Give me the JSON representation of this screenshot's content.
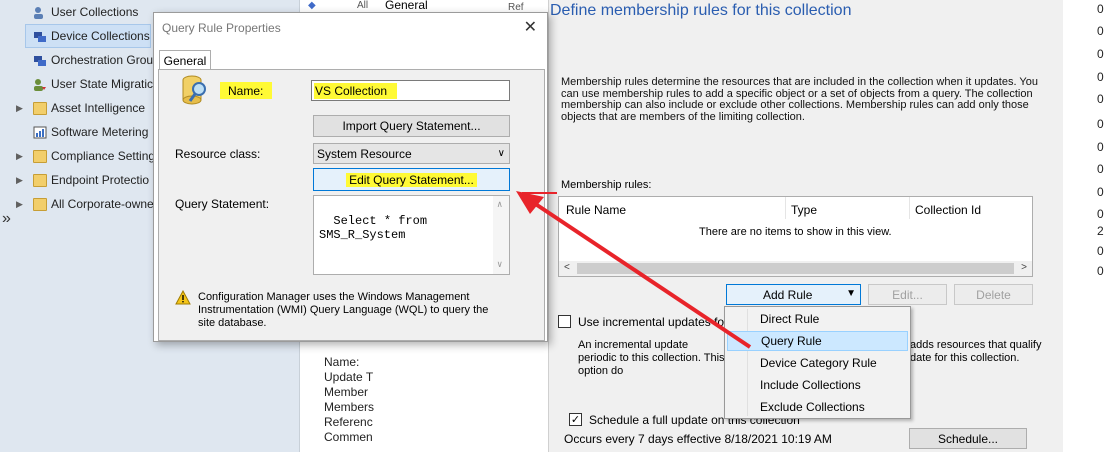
{
  "nav": {
    "items": [
      {
        "label": "User Collections",
        "icon": "user-collections-icon"
      },
      {
        "label": "Device Collections",
        "icon": "device-collections-icon",
        "selected": true
      },
      {
        "label": "Orchestration Grou",
        "icon": "orchestration-groups-icon"
      },
      {
        "label": "User State Migratic",
        "icon": "user-state-migration-icon"
      },
      {
        "label": "Asset Intelligence",
        "icon": "folder-icon",
        "expandable": true
      },
      {
        "label": "Software Metering",
        "icon": "software-metering-icon"
      },
      {
        "label": "Compliance Setting",
        "icon": "folder-icon",
        "expandable": true
      },
      {
        "label": "Endpoint Protectio",
        "icon": "folder-icon",
        "expandable": true
      },
      {
        "label": "All Corporate-owne",
        "icon": "folder-icon",
        "expandable": true
      }
    ],
    "collapse_glyph": "»"
  },
  "behind": {
    "top_labels": [
      "All",
      "General",
      "Ref"
    ],
    "props": [
      "Name:",
      "Update T",
      "Member",
      "Members",
      "Referenc",
      "Commen"
    ]
  },
  "right_col": {
    "values": [
      "0",
      "0",
      "0",
      "0",
      "0",
      "0",
      "0",
      "0",
      "0",
      "0",
      "2",
      "0",
      "0",
      "0"
    ]
  },
  "wizard": {
    "heading": "Define membership rules for this collection",
    "description": "Membership rules determine the resources that are included in the collection when it updates. You can use membership rules to add a specific object or a set of objects from a query. The collection membership can also include or exclude other collections. Membership rules can add only those objects that are members of the limiting collection.",
    "membership_rules_label": "Membership rules:",
    "columns": [
      "Rule Name",
      "Type",
      "Collection Id"
    ],
    "empty_text": "There are no items to show in this view.",
    "add_rule": "Add Rule",
    "edit": "Edit...",
    "delete": "Delete",
    "incremental_label": "Use incremental updates for this",
    "incremental_checked": false,
    "incremental_desc_left": "An incremental update periodic to this collection. This option do",
    "incremental_desc_right": "adds resources that qualify date for this collection.",
    "full_update_label": "Schedule a full update on this collection",
    "full_update_checked": true,
    "schedule_text": "Occurs every 7 days effective 8/18/2021 10:19 AM",
    "schedule_button": "Schedule..."
  },
  "add_rule_menu": {
    "items": [
      "Direct Rule",
      "Query Rule",
      "Device Category Rule",
      "Include Collections",
      "Exclude Collections"
    ],
    "highlighted": "Query Rule"
  },
  "dialog": {
    "title": "Query Rule Properties",
    "close_glyph": "✕",
    "tab": "General",
    "name_label": "Name:",
    "name_value": "VS Collection",
    "import_button": "Import Query Statement...",
    "resource_class_label": "Resource class:",
    "resource_class_value": "System Resource",
    "edit_button": "Edit Query Statement...",
    "query_label": "Query Statement:",
    "query_text": "Select * from\nSMS_R_System",
    "warning": "Configuration Manager uses the Windows Management Instrumentation (WMI) Query Language (WQL) to query the site database."
  },
  "colors": {
    "highlight_yellow": "#fffa35",
    "annotation_red": "#e8242a",
    "heading_blue": "#2a5db0",
    "focus_blue": "#0078d7"
  }
}
